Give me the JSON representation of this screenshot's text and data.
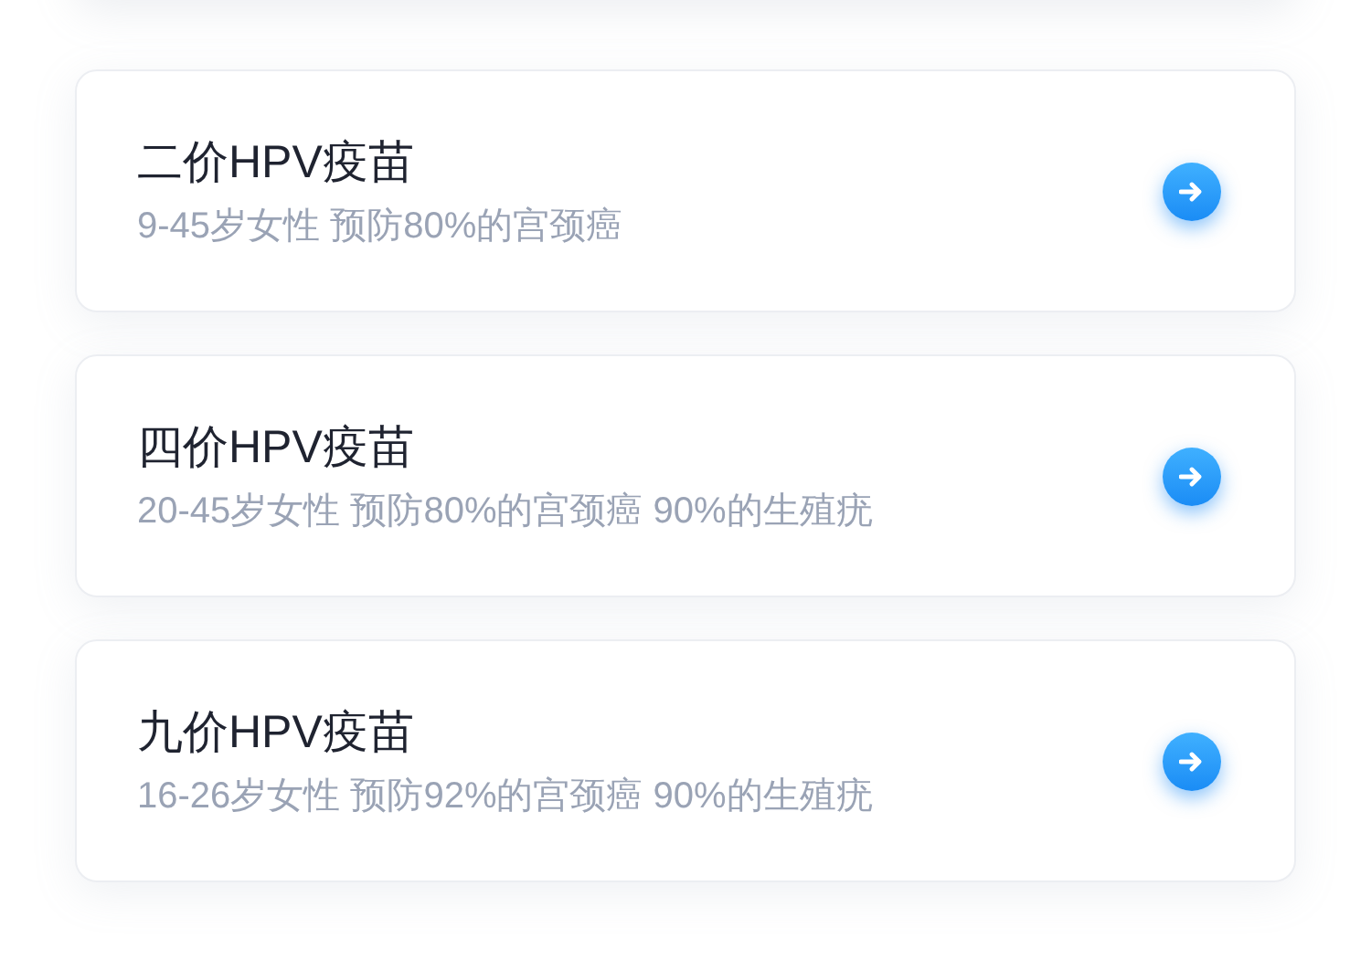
{
  "vaccines": [
    {
      "title": "二价HPV疫苗",
      "description": "9-45岁女性 预防80%的宫颈癌"
    },
    {
      "title": "四价HPV疫苗",
      "description": "20-45岁女性 预防80%的宫颈癌 90%的生殖疣"
    },
    {
      "title": "九价HPV疫苗",
      "description": "16-26岁女性 预防92%的宫颈癌 90%的生殖疣"
    }
  ]
}
